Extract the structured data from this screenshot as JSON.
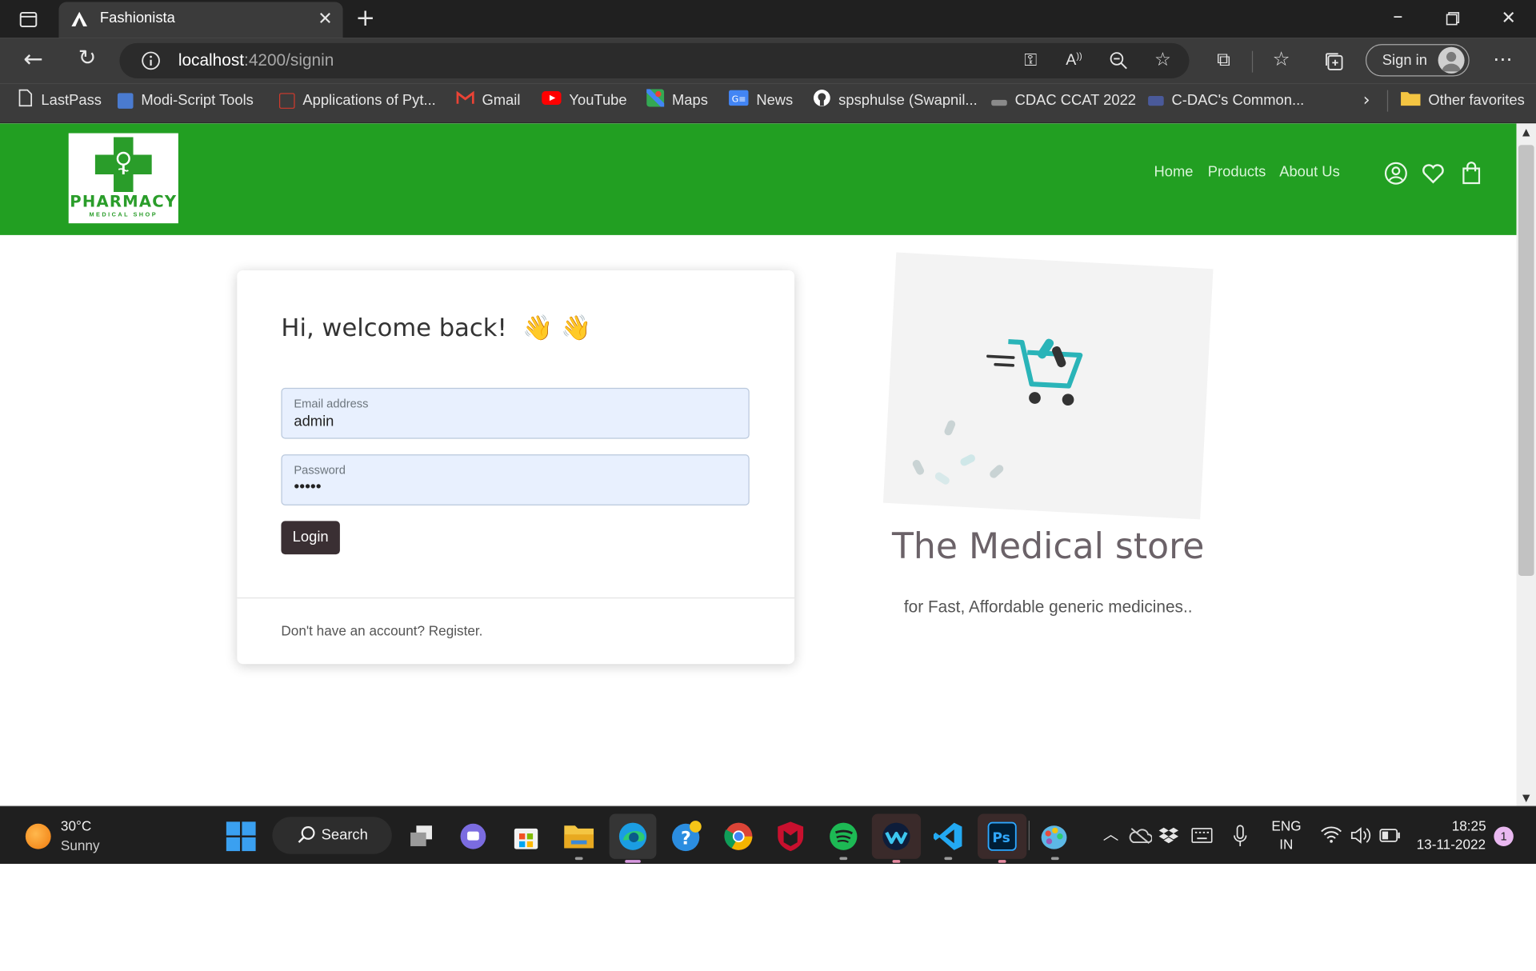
{
  "browser": {
    "tab_title": "Fashionista",
    "address_host": "localhost",
    "address_path": ":4200/signin",
    "sign_in_label": "Sign in",
    "favorites": [
      {
        "label": "LastPass",
        "icon": "page-icon",
        "color": "#e6e6e6"
      },
      {
        "label": "Modi-Script Tools",
        "icon": "tools-icon",
        "color": "#4a7bd0"
      },
      {
        "label": "Applications of Pyt...",
        "icon": "cc-icon",
        "color": "#d23a2c"
      },
      {
        "label": "Gmail",
        "icon": "gmail-icon",
        "color": "#ea4335"
      },
      {
        "label": "YouTube",
        "icon": "youtube-icon",
        "color": "#ff0000"
      },
      {
        "label": "Maps",
        "icon": "maps-icon",
        "color": "#34a853"
      },
      {
        "label": "News",
        "icon": "news-icon",
        "color": "#4285f4"
      },
      {
        "label": "spsphulse (Swapnil...",
        "icon": "github-icon",
        "color": "#ffffff"
      },
      {
        "label": "CDAC CCAT 2022",
        "icon": "cdac-icon",
        "color": "#8a8a8a"
      },
      {
        "label": "C-DAC's Common...",
        "icon": "ccat-icon",
        "color": "#4a5a9a"
      }
    ],
    "other_favorites": "Other favorites"
  },
  "site": {
    "logo_text": "PHARMACY",
    "logo_subtext": "MEDICAL SHOP",
    "nav": [
      "Home",
      "Products",
      "About Us"
    ],
    "brand_color": "#229f22"
  },
  "login": {
    "greeting": "Hi, welcome back!",
    "greeting_emoji": "👋 👋",
    "email_label": "Email address",
    "email_value": "admin",
    "password_label": "Password",
    "password_value": "•••••",
    "login_button": "Login",
    "register_text": "Don't have an account? Register."
  },
  "promo": {
    "title": "The Medical store",
    "subtitle": "for Fast, Affordable generic medicines.."
  },
  "taskbar": {
    "weather_temp": "30°C",
    "weather_desc": "Sunny",
    "search_label": "Search",
    "lang_line1": "ENG",
    "lang_line2": "IN",
    "time": "18:25",
    "date": "13-11-2022",
    "notification_count": "1"
  }
}
